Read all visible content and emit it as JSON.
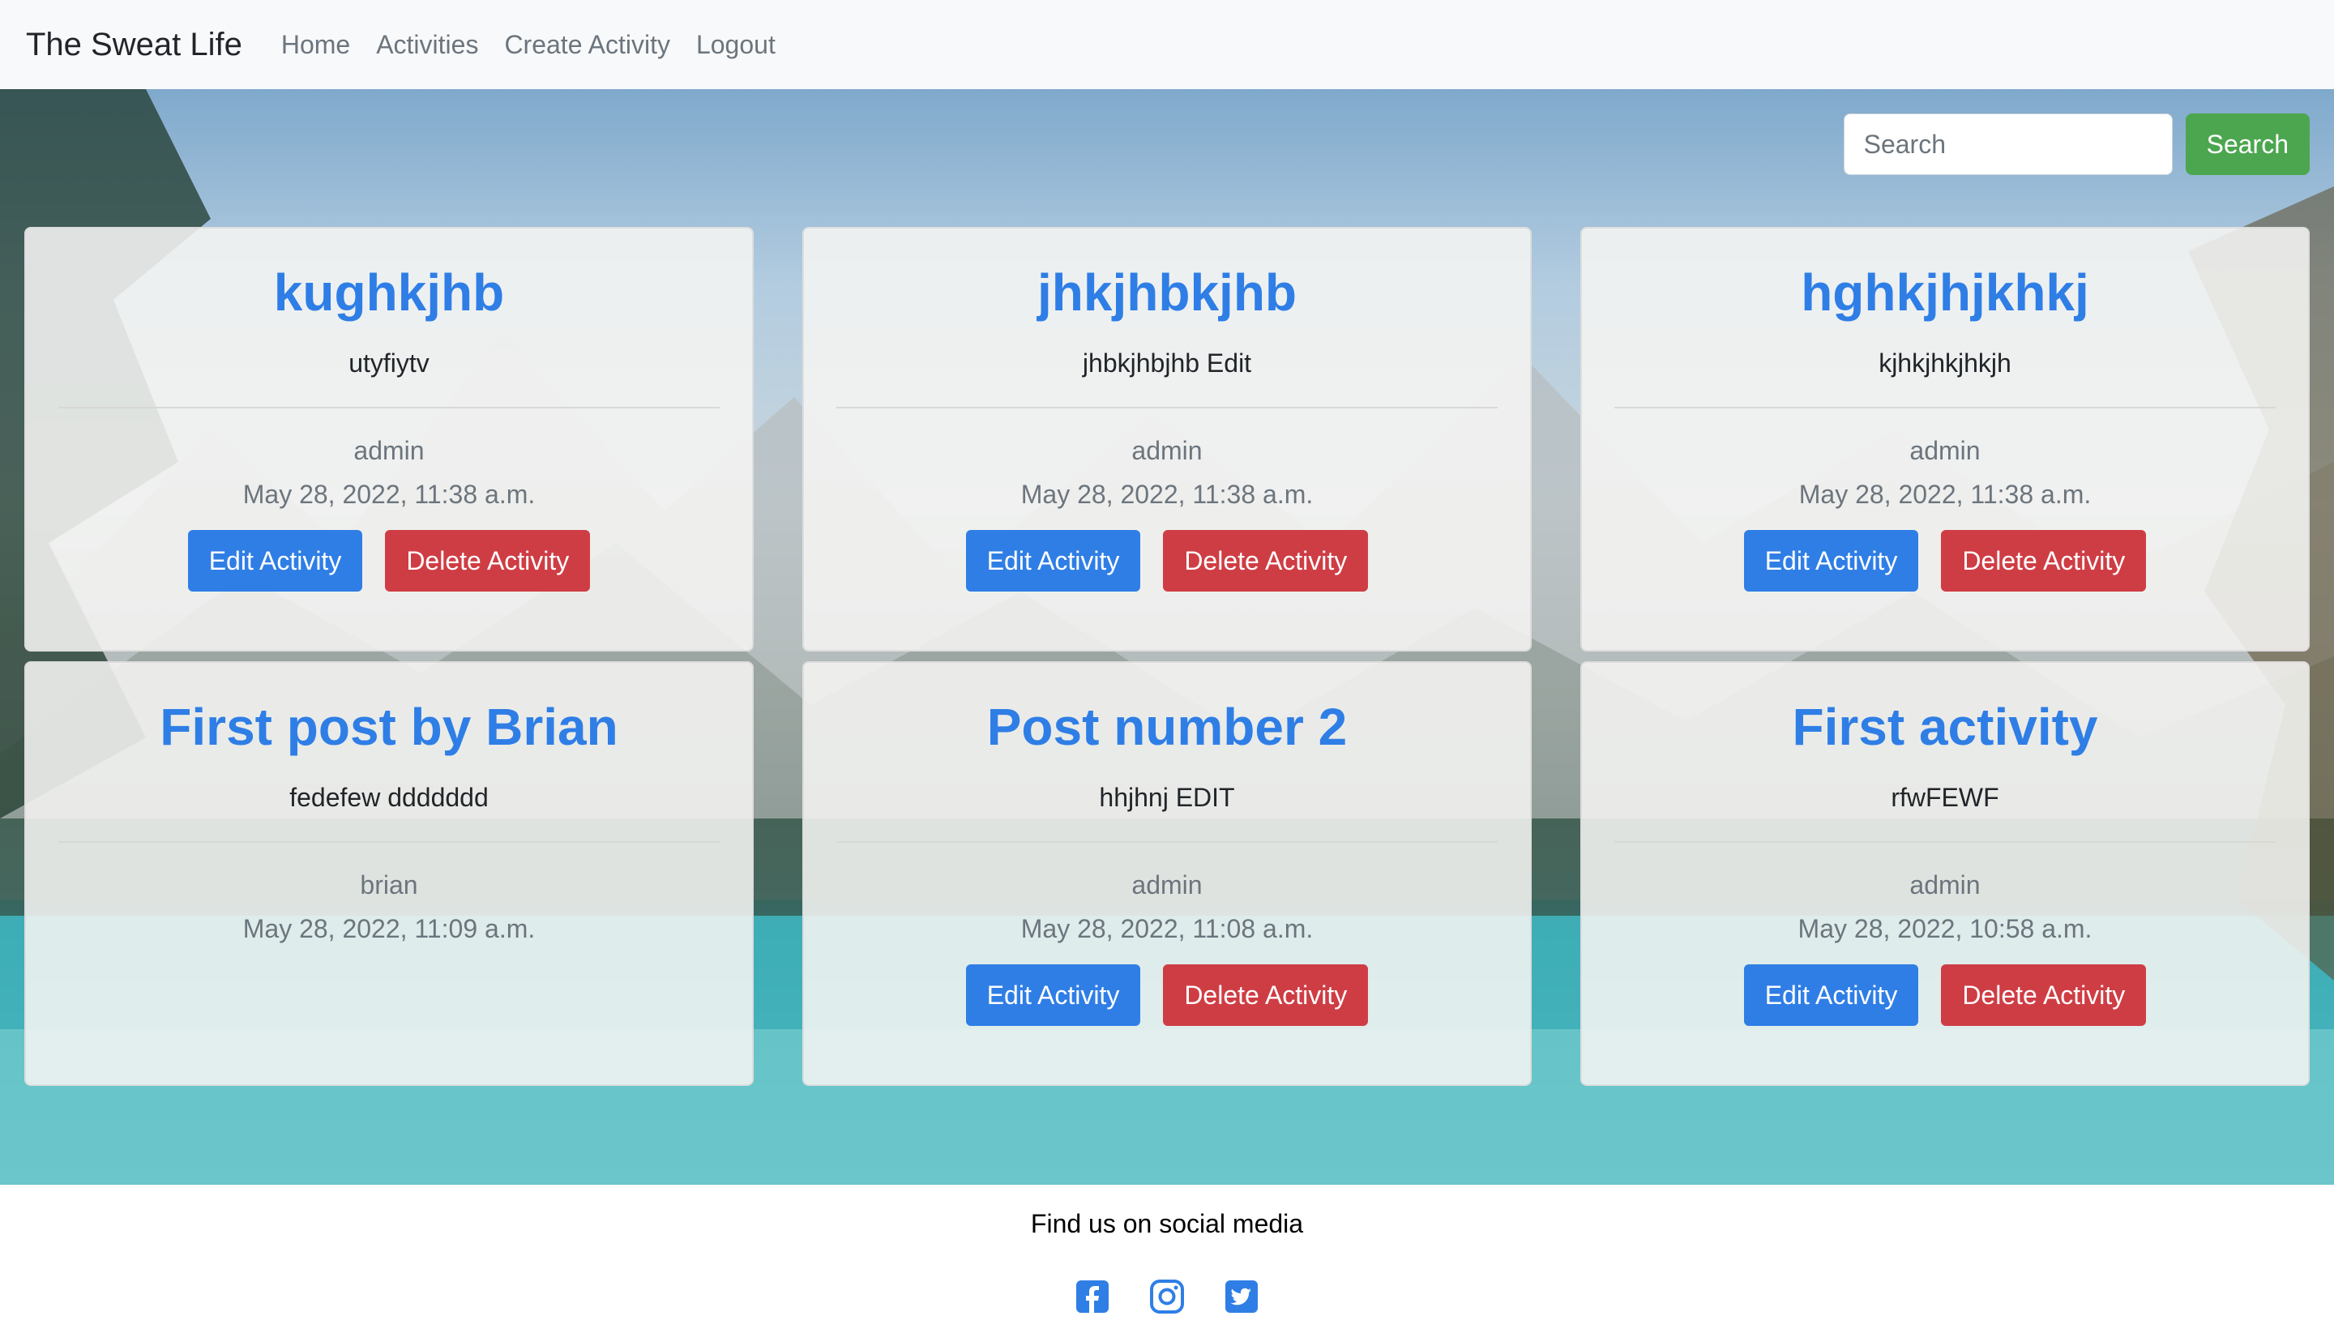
{
  "navbar": {
    "brand": "The Sweat Life",
    "links": [
      "Home",
      "Activities",
      "Create Activity",
      "Logout"
    ]
  },
  "search": {
    "placeholder": "Search",
    "button": "Search"
  },
  "cards": [
    {
      "title": "kughkjhb",
      "desc": "utyfiytv",
      "author": "admin",
      "date": "May 28, 2022, 11:38 a.m.",
      "edit": "Edit Activity",
      "delete": "Delete Activity"
    },
    {
      "title": "jhkjhbkjhb",
      "desc": "jhbkjhbjhb Edit",
      "author": "admin",
      "date": "May 28, 2022, 11:38 a.m.",
      "edit": "Edit Activity",
      "delete": "Delete Activity"
    },
    {
      "title": "hghkjhjkhkj",
      "desc": "kjhkjhkjhkjh",
      "author": "admin",
      "date": "May 28, 2022, 11:38 a.m.",
      "edit": "Edit Activity",
      "delete": "Delete Activity"
    },
    {
      "title": "First post by Brian",
      "desc": "fedefew ddddddd",
      "author": "brian",
      "date": "May 28, 2022, 11:09 a.m."
    },
    {
      "title": "Post number 2",
      "desc": "hhjhnj EDIT",
      "author": "admin",
      "date": "May 28, 2022, 11:08 a.m.",
      "edit": "Edit Activity",
      "delete": "Delete Activity"
    },
    {
      "title": "First activity",
      "desc": "rfwFEWF",
      "author": "admin",
      "date": "May 28, 2022, 10:58 a.m.",
      "edit": "Edit Activity",
      "delete": "Delete Activity"
    }
  ],
  "footer": {
    "text": "Find us on social media",
    "icons": [
      "facebook-icon",
      "instagram-icon",
      "twitter-icon"
    ]
  },
  "colors": {
    "primary": "#2f7ee6",
    "danger": "#cf3d44",
    "success": "#4ca64f",
    "social": "#2f7ee6"
  }
}
